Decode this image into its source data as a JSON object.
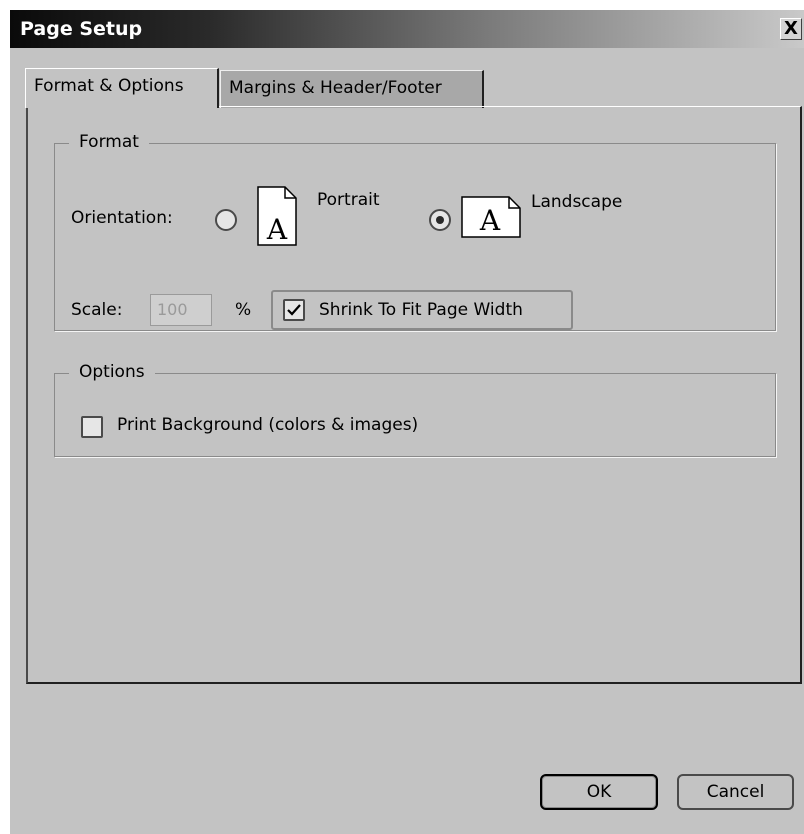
{
  "window": {
    "title": "Page Setup",
    "close_label": "X"
  },
  "tabs": [
    {
      "label": "Format & Options",
      "active": true
    },
    {
      "label": "Margins & Header/Footer",
      "active": false
    }
  ],
  "format": {
    "legend": "Format",
    "orientation_label": "Orientation:",
    "portrait_label": "Portrait",
    "landscape_label": "Landscape",
    "selected_orientation": "Landscape",
    "page_icon_glyph": "A",
    "scale_label": "Scale:",
    "scale_value": "100",
    "percent_label": "%",
    "shrink_label": "Shrink To Fit Page Width",
    "shrink_checked": true
  },
  "options": {
    "legend": "Options",
    "print_background_label": "Print Background (colors & images)",
    "print_background_checked": false
  },
  "buttons": {
    "ok_label": "OK",
    "cancel_label": "Cancel"
  },
  "colors": {
    "dialog_bg": "#c3c3c3",
    "title_gradient_start": "#0a0a0a",
    "title_gradient_end": "#c9c9c9"
  }
}
